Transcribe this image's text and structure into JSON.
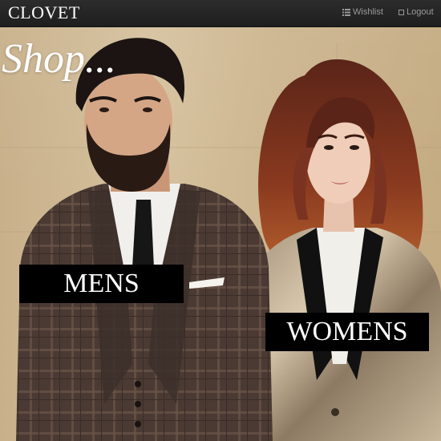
{
  "navbar": {
    "brand": "CLOVET",
    "wishlist_label": "Wishlist",
    "logout_label": "Logout"
  },
  "hero": {
    "heading": "Shop...",
    "categories": [
      {
        "label": "MENS"
      },
      {
        "label": "WOMENS"
      }
    ]
  },
  "colors": {
    "navbar_bg": "#222222",
    "nav_link": "#9a9a9a",
    "button_bg": "#000000",
    "button_text": "#ffffff"
  },
  "icons": {
    "wishlist": "list-icon",
    "logout": "box-icon"
  }
}
